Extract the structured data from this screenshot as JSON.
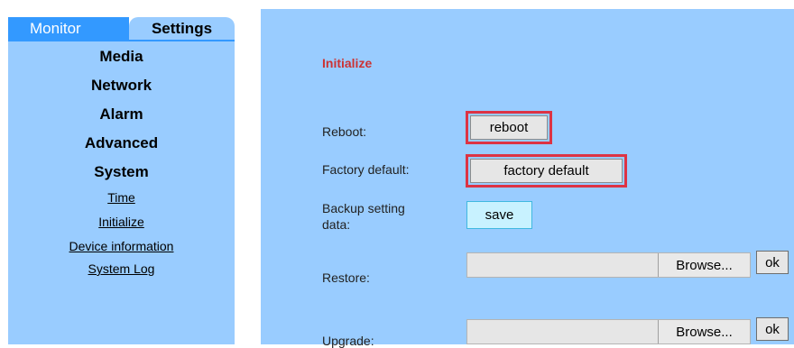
{
  "tabs": {
    "monitor": "Monitor",
    "settings": "Settings"
  },
  "sidebar": {
    "major_items": [
      "Media",
      "Network",
      "Alarm",
      "Advanced",
      "System"
    ],
    "system_items": [
      "Time",
      "Initialize",
      "Device information",
      "System Log"
    ]
  },
  "main": {
    "section_title": "Initialize",
    "reboot": {
      "label": "Reboot:",
      "button": "reboot"
    },
    "factory": {
      "label": "Factory default:",
      "button": "factory default"
    },
    "backup": {
      "label_line1": "Backup setting",
      "label_line2": "data:",
      "button": "save"
    },
    "restore": {
      "label": "Restore:",
      "browse": "Browse...",
      "ok": "ok"
    },
    "upgrade": {
      "label": "Upgrade:",
      "browse": "Browse...",
      "ok": "ok"
    }
  },
  "colors": {
    "panel_bg": "#99ccff",
    "active_tab": "#3399ff",
    "title_red": "#cc3333",
    "highlight_red": "#dd3344",
    "save_bg": "#c8f2ff"
  }
}
